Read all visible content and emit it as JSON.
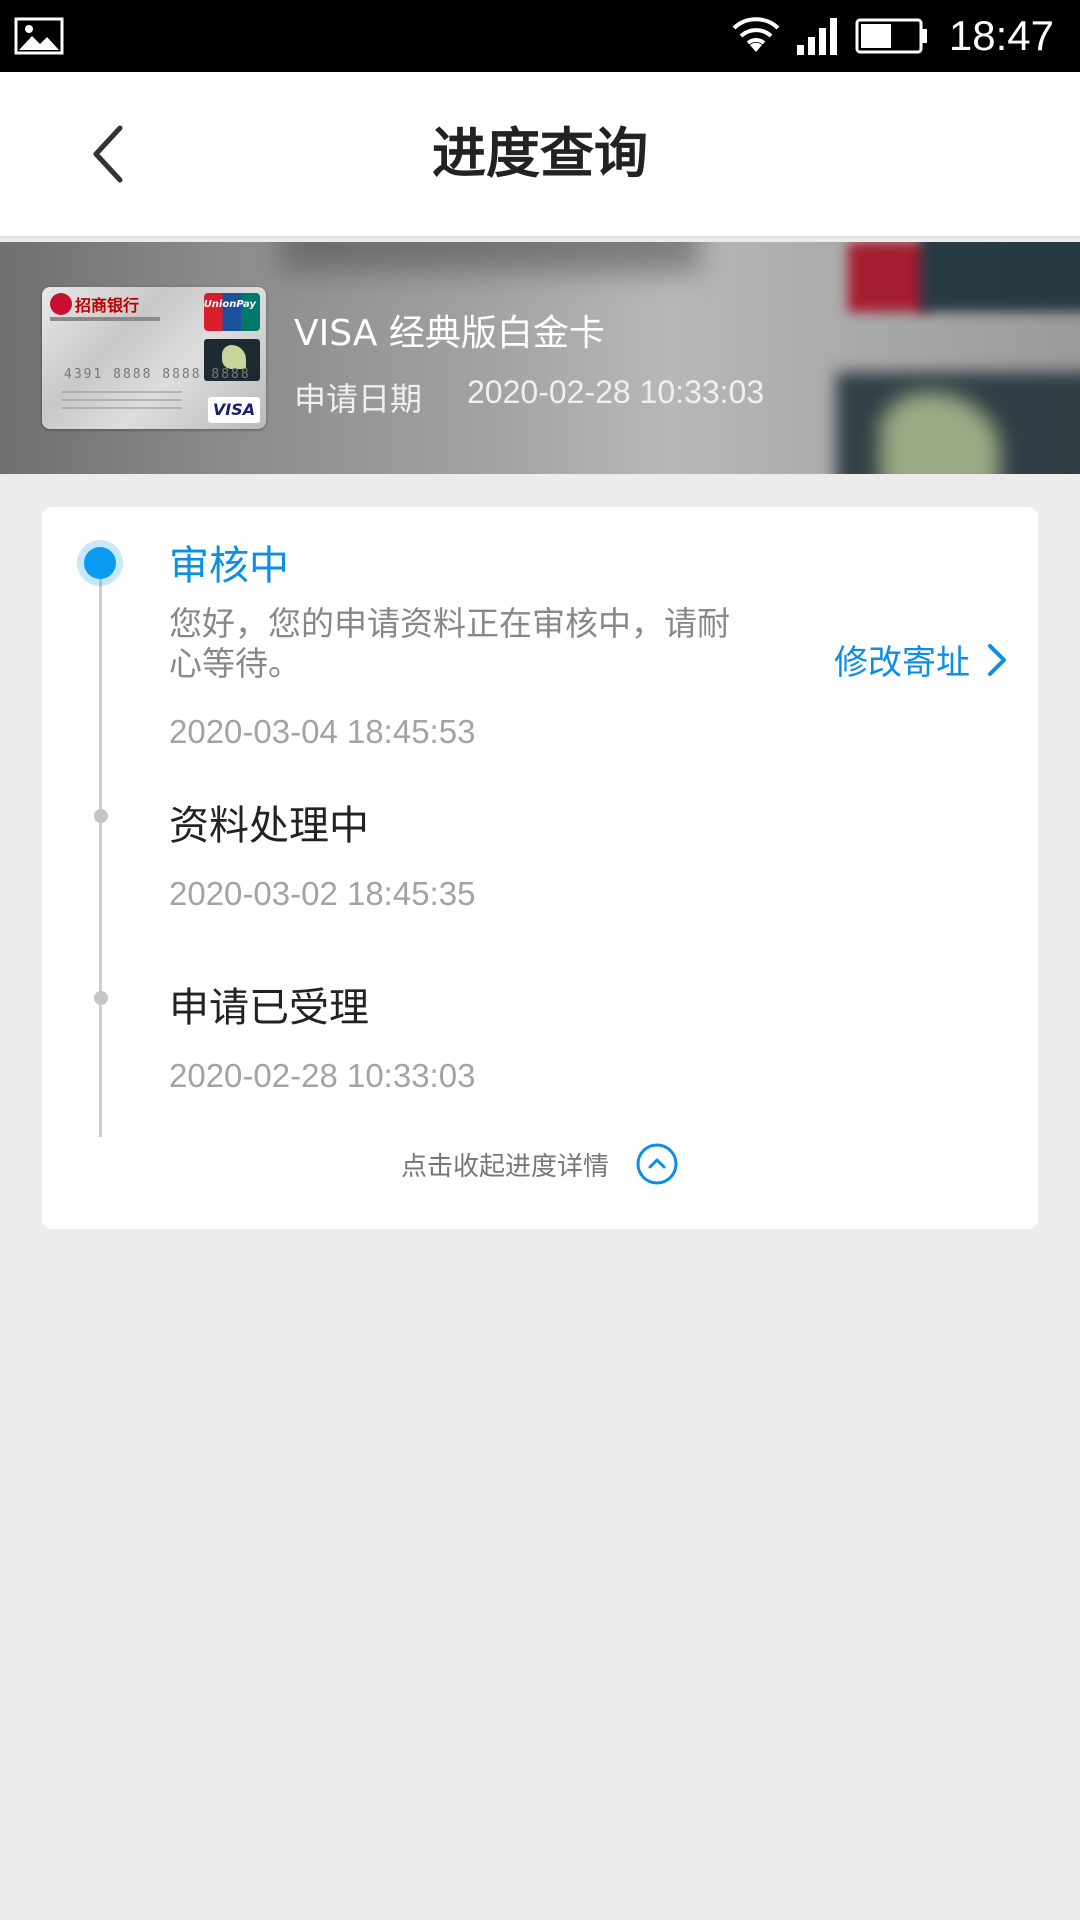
{
  "status_bar": {
    "time": "18:47",
    "icons": [
      "image-icon",
      "wifi-icon",
      "signal-icon",
      "battery-icon"
    ]
  },
  "header": {
    "title": "进度查询",
    "back_icon": "back-chevron-icon"
  },
  "banner": {
    "card_name": "VISA 经典版白金卡",
    "apply_date_label": "申请日期",
    "apply_date_value": "2020-02-28 10:33:03",
    "card_image": {
      "bank_name": "招商银行",
      "network": "VISA",
      "card_number": "4391 8888 8888 8888"
    }
  },
  "progress": {
    "steps": [
      {
        "title": "审核中",
        "description": "您好，您的申请资料正在审核中，请耐心等待。",
        "time": "2020-03-04 18:45:53",
        "active": true
      },
      {
        "title": "资料处理中",
        "time": "2020-03-02 18:45:35",
        "active": false
      },
      {
        "title": "申请已受理",
        "time": "2020-02-28 10:33:03",
        "active": false
      }
    ],
    "edit_address_label": "修改寄址",
    "collapse_label": "点击收起进度详情"
  },
  "colors": {
    "accent": "#0A8EE6",
    "page_background": "#ECECEC",
    "status_bar": "#000000",
    "text_primary": "#222222",
    "text_secondary": "#888888"
  }
}
